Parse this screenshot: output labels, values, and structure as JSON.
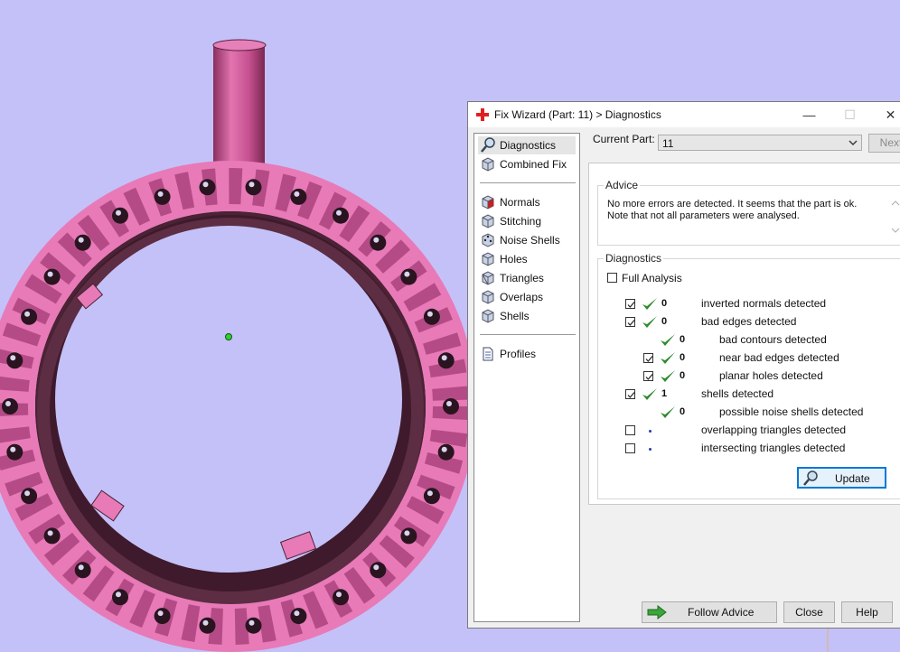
{
  "window": {
    "title": "Fix Wizard (Part: 11) > Diagnostics",
    "minimize": "—",
    "maximize": "☐",
    "close": "✕"
  },
  "nav": {
    "items": [
      {
        "label": "Diagnostics",
        "icon": "magnifier-icon"
      },
      {
        "label": "Combined Fix",
        "icon": "cube-icon"
      },
      {
        "label": "Normals",
        "icon": "cube-red-icon"
      },
      {
        "label": "Stitching",
        "icon": "cube-icon"
      },
      {
        "label": "Noise Shells",
        "icon": "cube-dots-icon"
      },
      {
        "label": "Holes",
        "icon": "cube-icon"
      },
      {
        "label": "Triangles",
        "icon": "cube-triangle-icon"
      },
      {
        "label": "Overlaps",
        "icon": "cube-icon"
      },
      {
        "label": "Shells",
        "icon": "cube-icon"
      },
      {
        "label": "Profiles",
        "icon": "document-icon"
      }
    ]
  },
  "current_part": {
    "label": "Current Part:",
    "value": "11"
  },
  "next_label": "Next",
  "advice": {
    "legend": "Advice",
    "line1": "No more errors are detected. It seems that the part is ok.",
    "line2": "Note that not all parameters were analysed."
  },
  "diagnostics": {
    "legend": "Diagnostics",
    "full_analysis": "Full Analysis",
    "full_analysis_checked": false,
    "rows": [
      {
        "count": "0",
        "label": "inverted normals detected",
        "checked": true,
        "indent": 0,
        "status": "ok"
      },
      {
        "count": "0",
        "label": "bad edges detected",
        "checked": true,
        "indent": 0,
        "status": "ok"
      },
      {
        "count": "0",
        "label": "bad contours detected",
        "checked": null,
        "indent": 1,
        "status": "ok"
      },
      {
        "count": "0",
        "label": "near bad edges detected",
        "checked": true,
        "indent": 1,
        "status": "ok"
      },
      {
        "count": "0",
        "label": "planar holes detected",
        "checked": true,
        "indent": 1,
        "status": "ok"
      },
      {
        "count": "1",
        "label": "shells detected",
        "checked": true,
        "indent": 0,
        "status": "ok"
      },
      {
        "count": "0",
        "label": "possible noise shells detected",
        "checked": null,
        "indent": 1,
        "status": "ok"
      },
      {
        "count": "",
        "label": "overlapping triangles detected",
        "checked": false,
        "indent": 0,
        "status": "none"
      },
      {
        "count": "",
        "label": "intersecting triangles detected",
        "checked": false,
        "indent": 0,
        "status": "none"
      }
    ],
    "update": "Update"
  },
  "buttons": {
    "follow_advice": "Follow Advice",
    "close": "Close",
    "help": "Help"
  },
  "colors": {
    "background": "#c4c1f8",
    "part_pink": "#e87ab8",
    "part_dark": "#4a2335",
    "check_green": "#2e8b2e",
    "selection": "#0078d7"
  }
}
